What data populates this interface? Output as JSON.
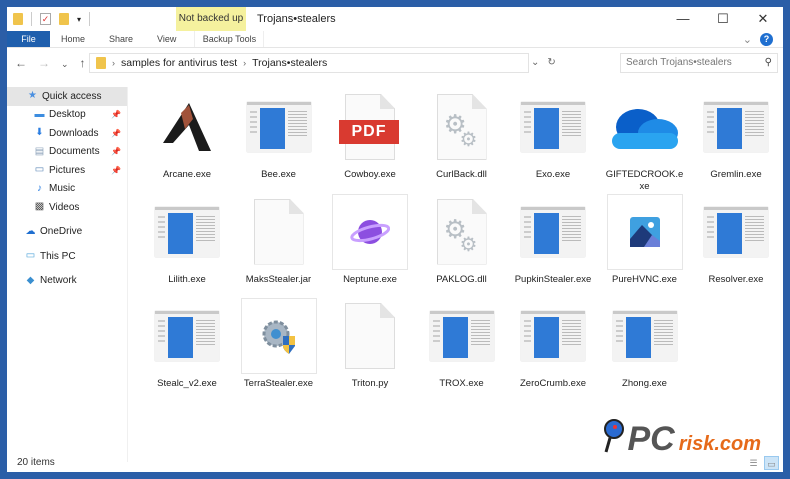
{
  "window": {
    "title": "Trojans•stealers",
    "context_tab": "Not backed up",
    "minimize": "—",
    "maximize": "☐",
    "close": "✕"
  },
  "ribbon": {
    "tabs": [
      "File",
      "Home",
      "Share",
      "View"
    ],
    "context_tab_label": "Backup Tools"
  },
  "address": {
    "segments": [
      "samples for antivirus test",
      "Trojans•stealers"
    ],
    "search_placeholder": "Search Trojans•stealers"
  },
  "sidebar": {
    "items": [
      {
        "label": "Quick access",
        "icon": "star-icon",
        "type": "qa",
        "color": "#4a8fe0"
      },
      {
        "label": "Desktop",
        "icon": "desktop-icon",
        "pinned": true,
        "color": "#3c8de0"
      },
      {
        "label": "Downloads",
        "icon": "download-arrow-icon",
        "pinned": true,
        "color": "#2a7de1"
      },
      {
        "label": "Documents",
        "icon": "document-icon",
        "pinned": true,
        "color": "#8aa0b8"
      },
      {
        "label": "Pictures",
        "icon": "pictures-icon",
        "pinned": true,
        "color": "#5a86b5"
      },
      {
        "label": "Music",
        "icon": "music-note-icon",
        "color": "#2a7de1"
      },
      {
        "label": "Videos",
        "icon": "videos-icon",
        "color": "#555"
      },
      {
        "label": "OneDrive",
        "icon": "cloud-icon",
        "type": "top",
        "color": "#1f6fd0"
      },
      {
        "label": "This PC",
        "icon": "computer-icon",
        "type": "top",
        "color": "#4aa0d8"
      },
      {
        "label": "Network",
        "icon": "network-icon",
        "type": "top",
        "color": "#3a8fd0"
      }
    ]
  },
  "files": [
    {
      "name": "Arcane.exe",
      "icon": "arcane-logo-icon"
    },
    {
      "name": "Bee.exe",
      "icon": "app-window-icon"
    },
    {
      "name": "Cowboy.exe",
      "icon": "pdf-icon",
      "icon_text": "PDF"
    },
    {
      "name": "CurlBack.dll",
      "icon": "gears-file-icon"
    },
    {
      "name": "Exo.exe",
      "icon": "app-window-icon"
    },
    {
      "name": "GIFTEDCROOK.exe",
      "icon": "onedrive-cloud-icon"
    },
    {
      "name": "Gremlin.exe",
      "icon": "app-window-icon"
    },
    {
      "name": "Lilith.exe",
      "icon": "app-window-icon"
    },
    {
      "name": "MaksStealer.jar",
      "icon": "blank-file-icon"
    },
    {
      "name": "Neptune.exe",
      "icon": "planet-icon",
      "framed": true
    },
    {
      "name": "PAKLOG.dll",
      "icon": "gears-file-icon"
    },
    {
      "name": "PupkinStealer.exe",
      "icon": "app-window-icon"
    },
    {
      "name": "PureHVNC.exe",
      "icon": "image-icon",
      "framed": true
    },
    {
      "name": "Resolver.exe",
      "icon": "app-window-icon"
    },
    {
      "name": "Stealc_v2.exe",
      "icon": "app-window-icon"
    },
    {
      "name": "TerraStealer.exe",
      "icon": "shield-gear-icon",
      "framed": true
    },
    {
      "name": "Triton.py",
      "icon": "blank-file-icon"
    },
    {
      "name": "TROX.exe",
      "icon": "app-window-icon"
    },
    {
      "name": "ZeroCrumb.exe",
      "icon": "app-window-icon"
    },
    {
      "name": "Zhong.exe",
      "icon": "app-window-icon"
    }
  ],
  "status": {
    "item_count": "20 items"
  },
  "watermark": {
    "text_pc": "PC",
    "text_risk": "risk.com"
  },
  "colors": {
    "accent": "#1f5fad",
    "frame": "#2b5ea7",
    "context_tab": "#f5f19e"
  }
}
